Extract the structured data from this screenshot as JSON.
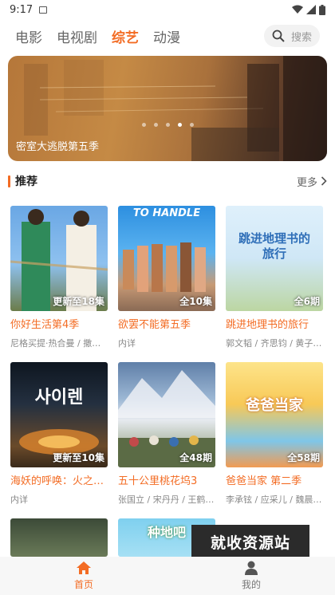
{
  "status_bar": {
    "time": "9:17"
  },
  "nav": {
    "tabs": [
      {
        "label": "电影",
        "active": false
      },
      {
        "label": "电视剧",
        "active": false
      },
      {
        "label": "综艺",
        "active": true
      },
      {
        "label": "动漫",
        "active": false
      }
    ],
    "search_placeholder": "搜索"
  },
  "banner": {
    "title": "密室大逃脱第五季",
    "dots": 5,
    "active_dot": 4
  },
  "section": {
    "title": "推荐",
    "more": "更多"
  },
  "cards": [
    {
      "title": "你好生活第4季",
      "subtitle": "尼格买提·热合曼 / 撒贝…",
      "badge": "更新至18集"
    },
    {
      "title": "欲罢不能第五季",
      "subtitle": "内详",
      "badge": "全10集",
      "thumb_text": "TO HANDLE"
    },
    {
      "title": "跳进地理书的旅行",
      "subtitle": "郭文韬 / 齐思钧 / 黄子…",
      "badge": "全6期",
      "thumb_text": "跳进地理书的旅行"
    },
    {
      "title": "海妖的呼唤：火之…",
      "subtitle": "内详",
      "badge": "更新至10集",
      "thumb_text": "사이렌"
    },
    {
      "title": "五十公里桃花坞3",
      "subtitle": "张国立 / 宋丹丹 / 王鹤…",
      "badge": "全48期"
    },
    {
      "title": "爸爸当家 第二季",
      "subtitle": "李承铉 / 应采儿 / 魏晨…",
      "badge": "全58期",
      "thumb_text": "爸爸当家"
    },
    {
      "title": "",
      "subtitle": "",
      "badge": ""
    },
    {
      "title": "",
      "subtitle": "",
      "badge": "",
      "thumb_text": "种地吧"
    }
  ],
  "watermark": "就收资源站",
  "bottom_nav": [
    {
      "label": "首页",
      "active": true
    },
    {
      "label": "我的",
      "active": false
    }
  ],
  "colors": {
    "accent": "#f36c24"
  }
}
